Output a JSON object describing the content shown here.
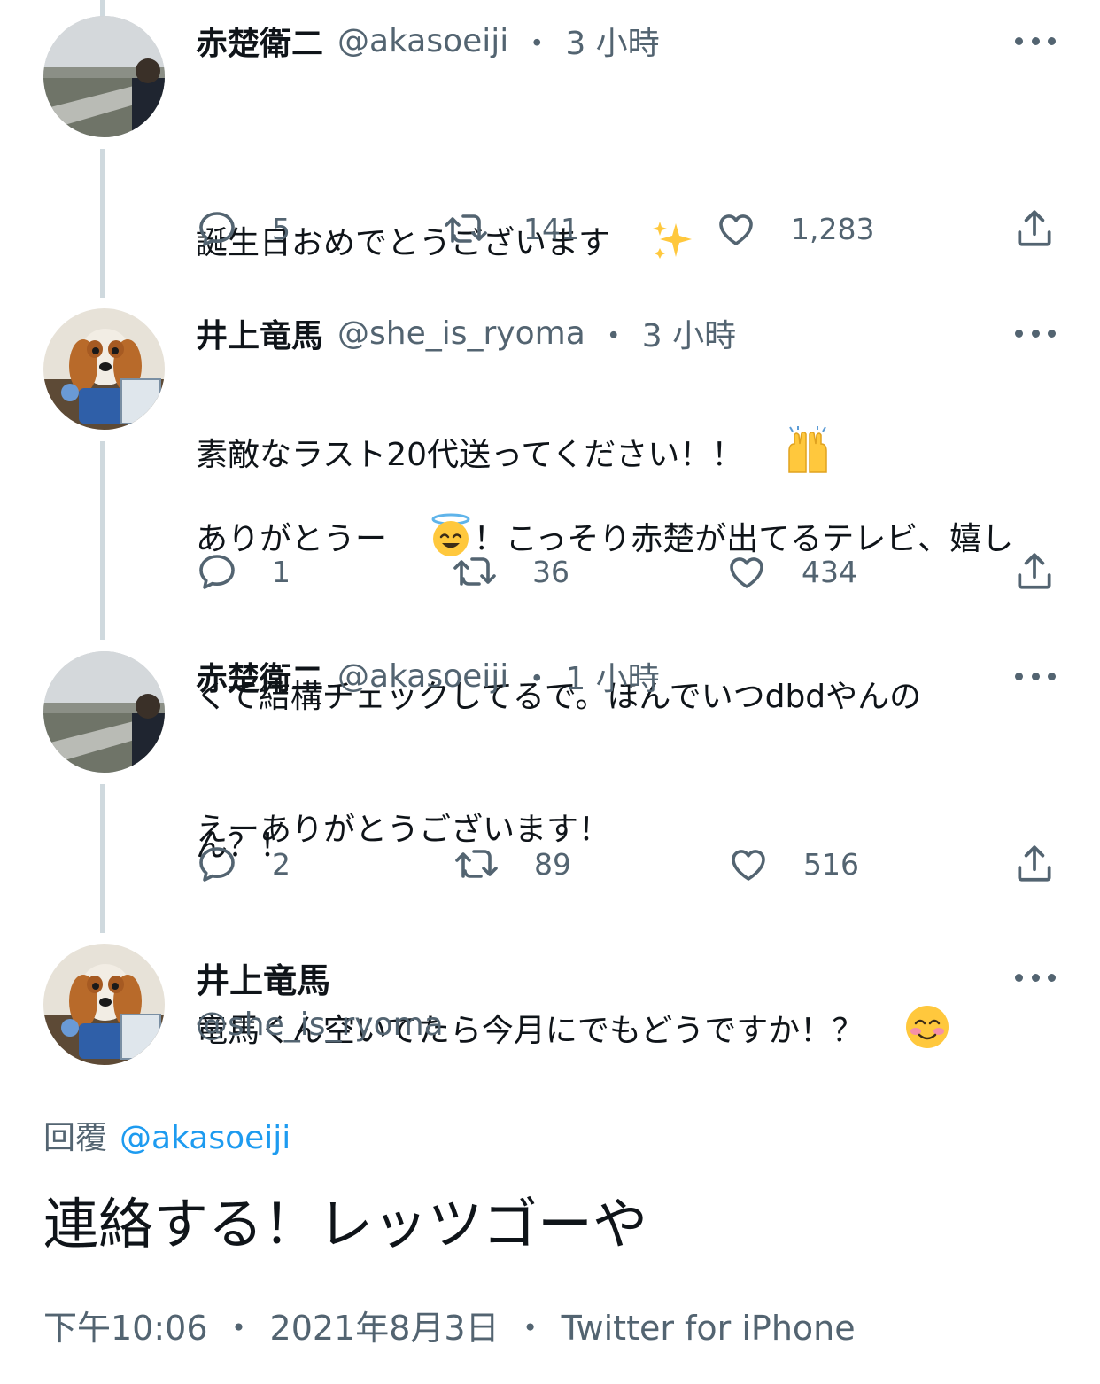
{
  "tweets": [
    {
      "name": "赤楚衛二",
      "handle": "@akasoeiji",
      "time": "3 小時",
      "lines": [
        "誕生日おめでとうございます",
        "素敵なラスト20代送ってください！！"
      ],
      "emojis": [
        "sparkles",
        "raising-hands"
      ],
      "replies": "5",
      "retweets": "141",
      "likes": "1,283"
    },
    {
      "name": "井上竜馬",
      "handle": "@she_is_ryoma",
      "time": "3 小時",
      "text_a": "ありがとうー",
      "text_b": "！こっそり赤楚が出てるテレビ、嬉し",
      "lines": [
        "くて結構チェックしてるで。ほんでいつdbdやんの",
        "ん？！"
      ],
      "emojis": [
        "smiling-face-with-halo"
      ],
      "replies": "1",
      "retweets": "36",
      "likes": "434"
    },
    {
      "name": "赤楚衛二",
      "handle": "@akasoeiji",
      "time": "1 小時",
      "lines": [
        "えーありがとうございます！",
        "竜馬くん空いてたら今月にでもどうですか！？"
      ],
      "emojis": [
        "smiling-face-with-smiling-eyes"
      ],
      "replies": "2",
      "retweets": "89",
      "likes": "516"
    }
  ],
  "main_tweet": {
    "name": "井上竜馬",
    "handle": "@she_is_ryoma",
    "reply_label": "回覆",
    "reply_mention": "@akasoeiji",
    "text": "連絡する！レッツゴーや",
    "time": "下午10:06",
    "date": "2021年8月3日",
    "source": "Twitter for iPhone"
  },
  "separator": "・",
  "colors": {
    "text": "#0f1419",
    "secondary": "#536471",
    "link": "#1d9bf0",
    "thread_line": "#cfd9de"
  },
  "icons": [
    "reply-icon",
    "retweet-icon",
    "like-icon",
    "share-icon",
    "more-icon"
  ]
}
